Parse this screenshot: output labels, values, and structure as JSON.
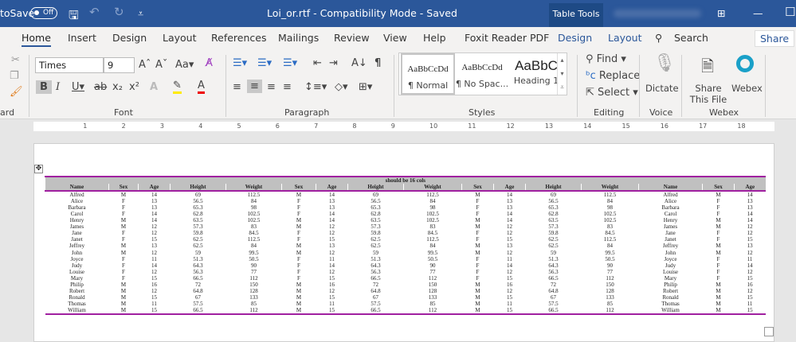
{
  "titlebar": {
    "autosave": "toSave",
    "autosave_state": "Off",
    "doc_title": "Loi_or.rtf  -  Compatibility Mode  -  Saved",
    "context": "Table Tools"
  },
  "tabs": [
    "Home",
    "Insert",
    "Design",
    "Layout",
    "References",
    "Mailings",
    "Review",
    "View",
    "Help",
    "Foxit Reader PDF",
    "Design",
    "Layout"
  ],
  "search": "Search",
  "share": "Share",
  "font": {
    "name": "Times",
    "size": "9"
  },
  "groups": {
    "clipboard": "ard",
    "font": "Font",
    "paragraph": "Paragraph",
    "styles": "Styles",
    "editing": "Editing",
    "voice": "Voice",
    "webex": "Webex"
  },
  "styles": [
    {
      "sample": "AaBbCcDd",
      "label": "¶ Normal"
    },
    {
      "sample": "AaBbCcDd",
      "label": "¶ No Spac..."
    },
    {
      "sample": "AaBbC",
      "label": "Heading 1"
    }
  ],
  "editing": {
    "find": "Find",
    "replace": "Replace",
    "select": "Select"
  },
  "voice": {
    "dictate": "Dictate"
  },
  "webex": {
    "share": "Share This File",
    "webex": "Webex"
  },
  "ruler_numbers": [
    "1",
    "2",
    "3",
    "4",
    "5",
    "6",
    "7",
    "8",
    "9",
    "10",
    "11",
    "12",
    "13",
    "14",
    "15",
    "16",
    "17",
    "18"
  ],
  "table": {
    "caption": "should be 16 cols",
    "headers": [
      "Name",
      "Sex",
      "Age",
      "Height",
      "Weight",
      "Sex",
      "Age",
      "Height",
      "Weight",
      "Sex",
      "Age",
      "Height",
      "Weight",
      "Name",
      "Sex",
      "Age"
    ],
    "rows": [
      [
        "Alfred",
        "M",
        "14",
        "69",
        "112.5"
      ],
      [
        "Alice",
        "F",
        "13",
        "56.5",
        "84"
      ],
      [
        "Barbara",
        "F",
        "13",
        "65.3",
        "98"
      ],
      [
        "Carol",
        "F",
        "14",
        "62.8",
        "102.5"
      ],
      [
        "Henry",
        "M",
        "14",
        "63.5",
        "102.5"
      ],
      [
        "James",
        "M",
        "12",
        "57.3",
        "83"
      ],
      [
        "Jane",
        "F",
        "12",
        "59.8",
        "84.5"
      ],
      [
        "Janet",
        "F",
        "15",
        "62.5",
        "112.5"
      ],
      [
        "Jeffrey",
        "M",
        "13",
        "62.5",
        "84"
      ],
      [
        "John",
        "M",
        "12",
        "59",
        "99.5"
      ],
      [
        "Joyce",
        "F",
        "11",
        "51.3",
        "50.5"
      ],
      [
        "Judy",
        "F",
        "14",
        "64.3",
        "90"
      ],
      [
        "Louise",
        "F",
        "12",
        "56.3",
        "77"
      ],
      [
        "Mary",
        "F",
        "15",
        "66.5",
        "112"
      ],
      [
        "Philip",
        "M",
        "16",
        "72",
        "150"
      ],
      [
        "Robert",
        "M",
        "12",
        "64.8",
        "128"
      ],
      [
        "Ronald",
        "M",
        "15",
        "67",
        "133"
      ],
      [
        "Thomas",
        "M",
        "11",
        "57.5",
        "85"
      ],
      [
        "William",
        "M",
        "15",
        "66.5",
        "112"
      ]
    ]
  }
}
